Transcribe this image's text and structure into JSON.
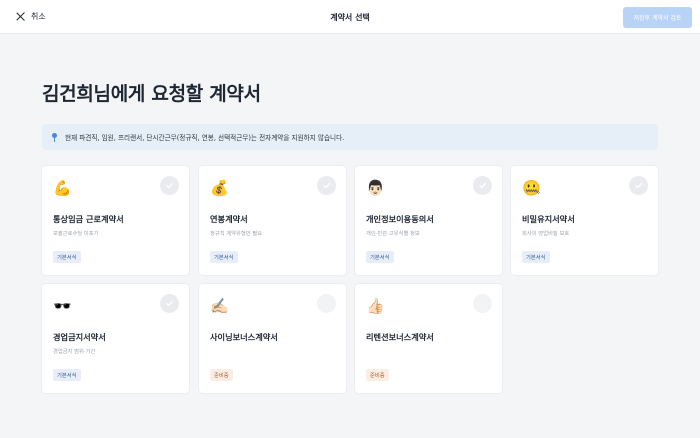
{
  "topbar": {
    "cancel_label": "취소",
    "title": "계약서 선택",
    "save_label": "저장후 계약서 검토"
  },
  "heading": "김건희님에게 요청할 계약서",
  "notice": {
    "text": "현재 파견직, 임원, 프리랜서, 단시간근무(정규직, 연봉, 선택적근무)는 전자계약을 지원하지 않습니다."
  },
  "colors": {
    "accent_disabled": "#b9d3f7",
    "notice_bg": "#e6eef8",
    "badge_basic_bg": "#e7eef9",
    "badge_prep_bg": "#fbede3"
  },
  "cards": [
    {
      "icon": "flexed-biceps-icon",
      "emoji": "💪",
      "title": "통상임금 근로계약서",
      "subtitle": "포괄근로수당 미포기",
      "badge": "기본서식"
    },
    {
      "icon": "money-bag-icon",
      "emoji": "💰",
      "title": "연봉계약서",
      "subtitle": "정규직 계약유형만 필요",
      "badge": "기본서식"
    },
    {
      "icon": "person-icon",
      "emoji": "👨🏻",
      "title": "개인정보이용동의서",
      "subtitle": "개인·민감·고유식별 정보",
      "badge": "기본서식"
    },
    {
      "icon": "zipper-mouth-face-icon",
      "emoji": "🤐",
      "title": "비밀유지서약서",
      "subtitle": "회사의 영업비밀 보호",
      "badge": "기본서식"
    },
    {
      "icon": "sunglasses-icon",
      "emoji": "🕶️",
      "title": "경업금지서약서",
      "subtitle": "경업금지 범위·기간",
      "badge": "기본서식"
    },
    {
      "icon": "writing-hand-icon",
      "emoji": "✍🏻",
      "title": "사이닝보너스계약서",
      "subtitle": "",
      "badge": "준비중"
    },
    {
      "icon": "thumbs-up-icon",
      "emoji": "👍🏻",
      "title": "리텐션보너스계약서",
      "subtitle": "",
      "badge": "준비중"
    }
  ]
}
